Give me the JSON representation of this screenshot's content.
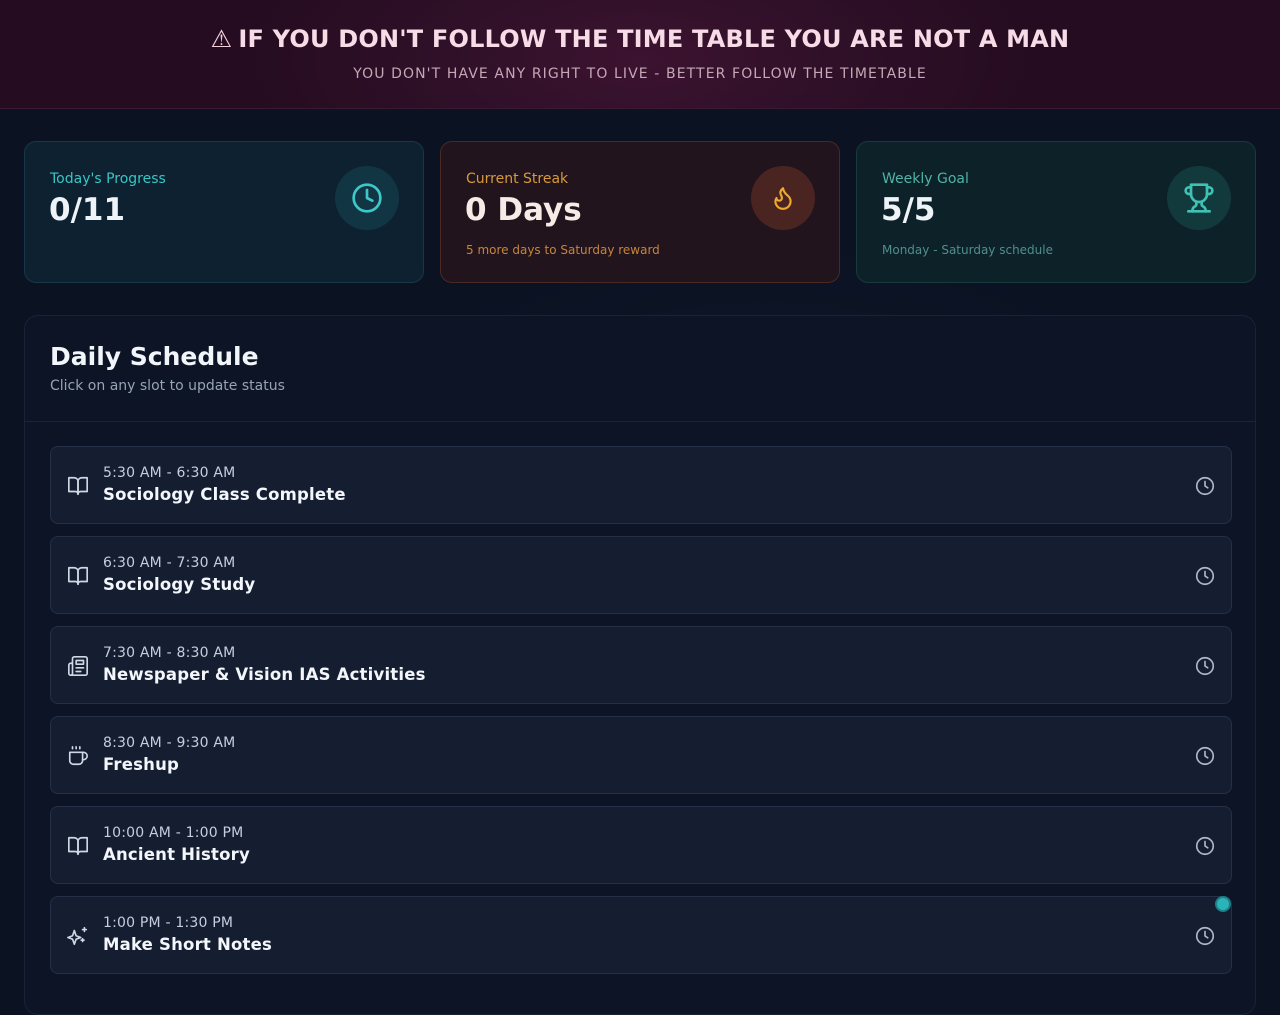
{
  "banner": {
    "warning_glyph": "⚠",
    "title": "IF YOU DON'T FOLLOW THE TIME TABLE YOU ARE NOT A MAN",
    "subtitle": "YOU DON'T HAVE ANY RIGHT TO LIVE - BETTER FOLLOW THE TIMETABLE"
  },
  "stats": {
    "progress": {
      "label": "Today's Progress",
      "value": "0/11",
      "icon": "clock-icon"
    },
    "streak": {
      "label": "Current Streak",
      "value": "0 Days",
      "note": "5 more days to Saturday reward",
      "icon": "flame-icon"
    },
    "weekly": {
      "label": "Weekly Goal",
      "value": "5/5",
      "note": "Monday - Saturday schedule",
      "icon": "trophy-icon"
    }
  },
  "schedule": {
    "title": "Daily Schedule",
    "subtitle": "Click on any slot to update status",
    "slots": [
      {
        "time": "5:30 AM - 6:30 AM",
        "title": "Sociology Class Complete",
        "icon": "book-icon",
        "status": "pending"
      },
      {
        "time": "6:30 AM - 7:30 AM",
        "title": "Sociology Study",
        "icon": "book-icon",
        "status": "pending"
      },
      {
        "time": "7:30 AM - 8:30 AM",
        "title": "Newspaper & Vision IAS Activities",
        "icon": "newspaper-icon",
        "status": "pending"
      },
      {
        "time": "8:30 AM - 9:30 AM",
        "title": "Freshup",
        "icon": "coffee-icon",
        "status": "pending"
      },
      {
        "time": "10:00 AM - 1:00 PM",
        "title": "Ancient History",
        "icon": "book-icon",
        "status": "pending"
      },
      {
        "time": "1:00 PM - 1:30 PM",
        "title": "Make Short Notes",
        "icon": "sparkles-icon",
        "status": "pending"
      }
    ]
  },
  "colors": {
    "accent_teal": "#38c6c6",
    "accent_orange": "#d79a3a",
    "accent_green": "#4fb3a6",
    "banner_bg": "#2c0f26"
  }
}
